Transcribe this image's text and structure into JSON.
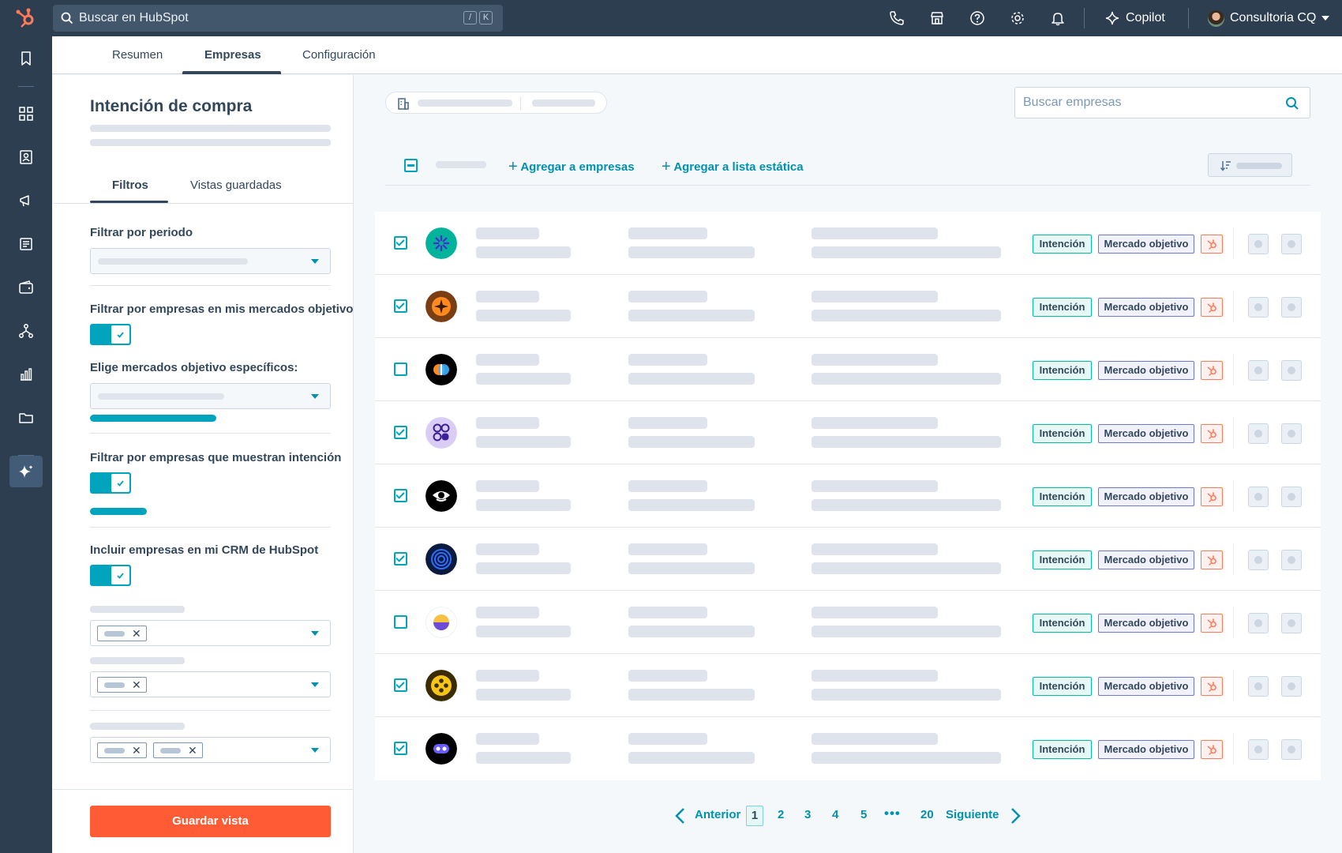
{
  "topnav": {
    "search_placeholder": "Buscar en HubSpot",
    "shortcut_keys": [
      "/",
      "K"
    ],
    "copilot_label": "Copilot",
    "account_name": "Consultoria CQ",
    "icons": [
      "phone-icon",
      "marketplace-icon",
      "help-icon",
      "settings-icon",
      "notifications-icon"
    ]
  },
  "tabs": [
    "Resumen",
    "Empresas",
    "Configuración"
  ],
  "active_tab": "Empresas",
  "filter_panel": {
    "title": "Intención de compra",
    "tabs": [
      "Filtros",
      "Vistas guardadas"
    ],
    "period_label": "Filtrar por periodo",
    "target_markets_label": "Filtrar por empresas en mis mercados objetivo",
    "target_markets_on": true,
    "choose_markets_label": "Elige mercados objetivo específicos:",
    "intent_label": "Filtrar por empresas que muestran intención",
    "intent_on": true,
    "crm_label": "Incluir empresas en mi CRM de HubSpot",
    "crm_on": true,
    "save_button": "Guardar vista"
  },
  "content": {
    "search_placeholder": "Buscar empresas",
    "add_to_companies": "Agregar a empresas",
    "add_to_static_list": "Agregar a lista estática"
  },
  "rows": [
    {
      "checked": true,
      "logo": "#00b39a",
      "tags": [
        "Intención",
        "Mercado objetivo"
      ]
    },
    {
      "checked": true,
      "logo": "#7a3e12",
      "tags": [
        "Intención",
        "Mercado objetivo"
      ]
    },
    {
      "checked": false,
      "logo": "#000000",
      "tags": [
        "Intención",
        "Mercado objetivo"
      ]
    },
    {
      "checked": true,
      "logo": "#d9ccf5",
      "tags": [
        "Intención",
        "Mercado objetivo"
      ]
    },
    {
      "checked": true,
      "logo": "#000000",
      "tags": [
        "Intención",
        "Mercado objetivo"
      ]
    },
    {
      "checked": true,
      "logo": "#0b1b3f",
      "tags": [
        "Intención",
        "Mercado objetivo"
      ]
    },
    {
      "checked": false,
      "logo": "#ffffff",
      "tags": [
        "Intención",
        "Mercado objetivo"
      ]
    },
    {
      "checked": true,
      "logo": "#3a2c00",
      "tags": [
        "Intención",
        "Mercado objetivo"
      ]
    },
    {
      "checked": true,
      "logo": "#000000",
      "tags": [
        "Intención",
        "Mercado objetivo"
      ]
    }
  ],
  "pagination": {
    "prev": "Anterior",
    "pages": [
      "1",
      "2",
      "3",
      "4",
      "5"
    ],
    "ellipsis": "•••",
    "last": "20",
    "next": "Siguiente",
    "current": "1"
  },
  "colors": {
    "nav": "#2d3e50",
    "accent": "#00a4bd",
    "link": "#0091ae",
    "primary_button": "#ff5c35"
  }
}
